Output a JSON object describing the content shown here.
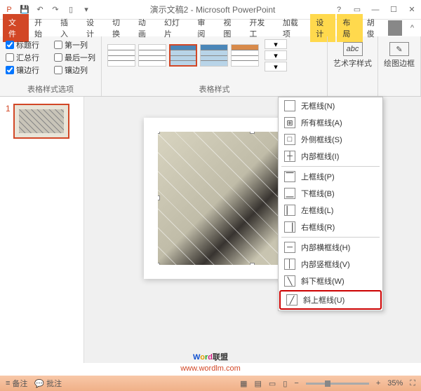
{
  "title": "演示文稿2 - Microsoft PowerPoint",
  "user": "胡俊",
  "tabs": {
    "file": "文件",
    "home": "开始",
    "insert": "插入",
    "design": "设计",
    "transition": "切换",
    "animation": "动画",
    "slideshow": "幻灯片",
    "review": "审阅",
    "view": "视图",
    "developer": "开发工",
    "addin": "加载项",
    "ctx_design": "设计",
    "ctx_layout": "布局"
  },
  "checks": {
    "header_row": "标题行",
    "first_col": "第一列",
    "total_row": "汇总行",
    "last_col": "最后一列",
    "banded_row": "镶边行",
    "banded_col": "镶边列"
  },
  "group_labels": {
    "style_options": "表格样式选项",
    "table_styles": "表格样式",
    "wordart": "艺术字样式",
    "borders": "绘图边框"
  },
  "border_menu": [
    {
      "icon": "none",
      "label": "无框线(N)"
    },
    {
      "icon": "all",
      "label": "所有框线(A)"
    },
    {
      "icon": "outer",
      "label": "外侧框线(S)"
    },
    {
      "icon": "inner",
      "label": "内部框线(I)"
    },
    {
      "sep": true
    },
    {
      "icon": "top",
      "label": "上框线(P)"
    },
    {
      "icon": "bottom",
      "label": "下框线(B)"
    },
    {
      "icon": "left",
      "label": "左框线(L)"
    },
    {
      "icon": "right",
      "label": "右框线(R)"
    },
    {
      "sep": true
    },
    {
      "icon": "inh",
      "label": "内部横框线(H)"
    },
    {
      "icon": "inv",
      "label": "内部竖框线(V)"
    },
    {
      "icon": "ddown",
      "label": "斜下框线(W)"
    },
    {
      "icon": "dup",
      "label": "斜上框线(U)",
      "hl": true
    }
  ],
  "slide_num": "1",
  "watermark": {
    "text": "Word联盟",
    "url": "www.wordlm.com"
  },
  "status": {
    "notes": "备注",
    "comments": "批注",
    "zoom": "35%"
  }
}
